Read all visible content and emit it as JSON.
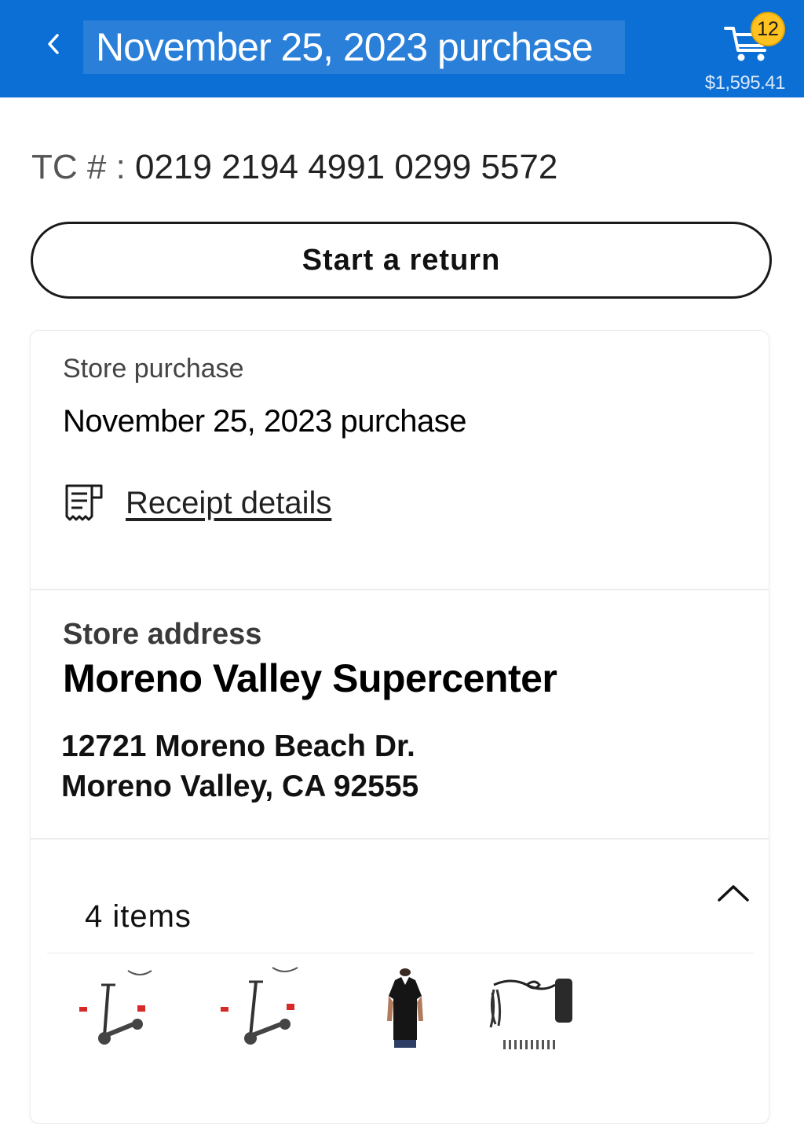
{
  "header": {
    "title": "November 25, 2023 purchase",
    "back_icon": "chevron-left-icon",
    "cart_icon": "cart-icon",
    "cart_count": "12",
    "cart_total": "$1,595.41",
    "bg_color": "#0b6fd6",
    "badge_color": "#ffc220"
  },
  "transaction": {
    "label": "TC # :",
    "number": "0219 2194 4991 0299 5572"
  },
  "return_button": {
    "label": "Start a return"
  },
  "purchase": {
    "type_label": "Store purchase",
    "date_label": "November 25, 2023 purchase",
    "receipt_icon": "receipt-icon",
    "receipt_link": "Receipt details"
  },
  "store": {
    "section_label": "Store address",
    "name": "Moreno Valley Supercenter",
    "address_line1": "12721 Moreno Beach Dr.",
    "address_line2": "Moreno Valley, CA 92555"
  },
  "items": {
    "count_label": "4 items",
    "collapse_icon": "chevron-up-icon",
    "thumbnails": [
      {
        "icon": "electric-scooter-icon"
      },
      {
        "icon": "electric-scooter-icon"
      },
      {
        "icon": "t-shirt-icon"
      },
      {
        "icon": "power-adapter-icon"
      }
    ]
  }
}
